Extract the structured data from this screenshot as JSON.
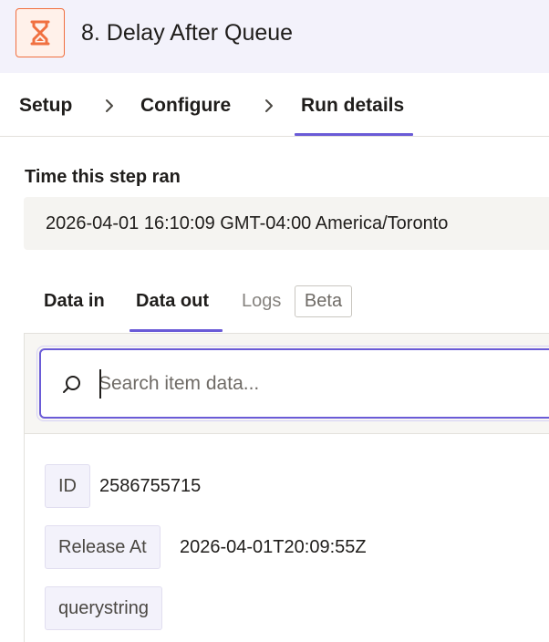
{
  "header": {
    "icon": "hourglass-icon",
    "step_title": "8. Delay After Queue",
    "brand_color": "#f07040"
  },
  "breadcrumbs": [
    {
      "label": "Setup"
    },
    {
      "label": "Configure"
    },
    {
      "label": "Run details",
      "active": true
    }
  ],
  "run_time": {
    "label": "Time this step ran",
    "value": "2026-04-01 16:10:09 GMT-04:00 America/Toronto"
  },
  "tabs": [
    {
      "label": "Data in"
    },
    {
      "label": "Data out",
      "active": true
    },
    {
      "label": "Logs",
      "badge": "Beta"
    }
  ],
  "search": {
    "placeholder": "Search item data...",
    "value": ""
  },
  "fields": [
    {
      "key": "ID",
      "value": "2586755715"
    },
    {
      "key": "Release At",
      "value": "2026-04-01T20:09:55Z"
    },
    {
      "key": "querystring",
      "value": ""
    }
  ],
  "accent_color": "#6a5bd7"
}
